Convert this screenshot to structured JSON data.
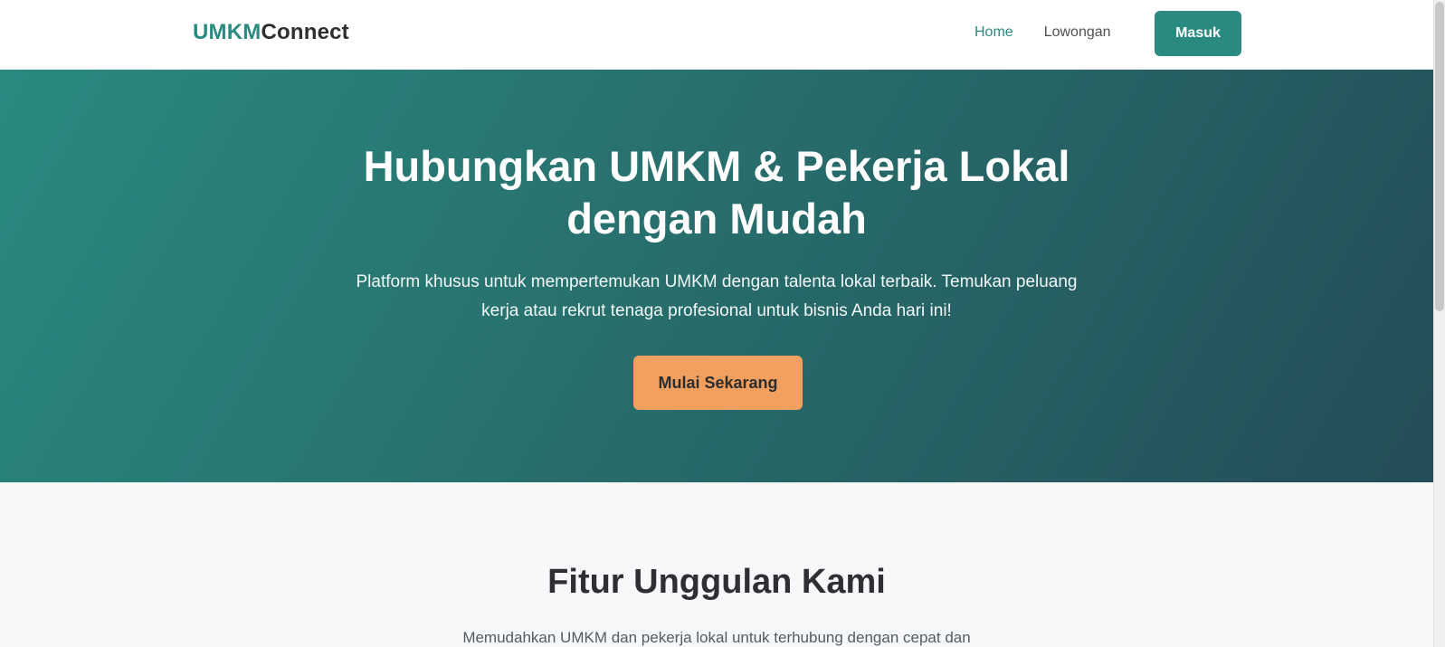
{
  "navbar": {
    "brand": {
      "part1": "UMKM",
      "part2": "Connect"
    },
    "links": [
      {
        "label": "Home",
        "active": true
      },
      {
        "label": "Lowongan",
        "active": false
      }
    ],
    "login_label": "Masuk"
  },
  "hero": {
    "title": "Hubungkan UMKM & Pekerja Lokal dengan Mudah",
    "subtitle": "Platform khusus untuk mempertemukan UMKM dengan talenta lokal terbaik. Temukan peluang kerja atau rekrut tenaga profesional untuk bisnis Anda hari ini!",
    "cta_label": "Mulai Sekarang"
  },
  "features": {
    "title": "Fitur Unggulan Kami",
    "subtitle": "Memudahkan UMKM dan pekerja lokal untuk terhubung dengan cepat dan"
  },
  "colors": {
    "primary": "#2a8a80",
    "hero_gradient_start": "#2a8a80",
    "hero_gradient_end": "#244d57",
    "accent_orange": "#f2a05f",
    "text_dark": "#2d2f33",
    "page_bg": "#f7f8fa"
  }
}
